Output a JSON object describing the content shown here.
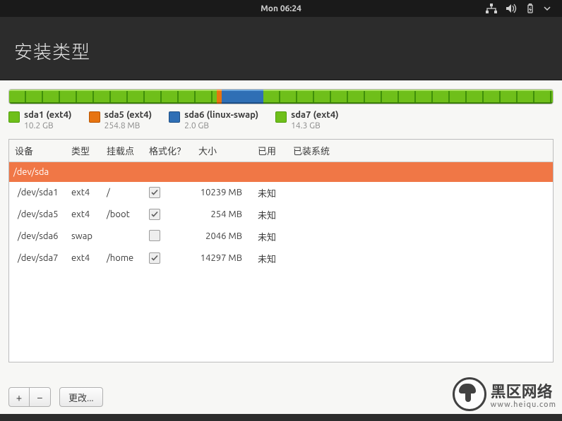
{
  "topbar": {
    "clock": "Mon 06:24"
  },
  "header": {
    "title": "安装类型"
  },
  "legend": [
    {
      "color": "green",
      "label": "sda1 (ext4)",
      "size": "10.2 GB"
    },
    {
      "color": "orange",
      "label": "sda5 (ext4)",
      "size": "254.8 MB"
    },
    {
      "color": "blue",
      "label": "sda6 (linux-swap)",
      "size": "2.0 GB"
    },
    {
      "color": "green",
      "label": "sda7 (ext4)",
      "size": "14.3 GB"
    }
  ],
  "columns": {
    "device": "设备",
    "type": "类型",
    "mount": "挂载点",
    "format": "格式化？",
    "size": "大小",
    "used": "已用",
    "system": "已装系统"
  },
  "rows": [
    {
      "device": "/dev/sda",
      "type": "",
      "mount": "",
      "format": null,
      "size": "",
      "used": "",
      "selected": true
    },
    {
      "device": "/dev/sda1",
      "type": "ext4",
      "mount": "/",
      "format": true,
      "size": "10239 MB",
      "used": "未知"
    },
    {
      "device": "/dev/sda5",
      "type": "ext4",
      "mount": "/boot",
      "format": true,
      "size": "254 MB",
      "used": "未知"
    },
    {
      "device": "/dev/sda6",
      "type": "swap",
      "mount": "",
      "format": false,
      "size": "2046 MB",
      "used": "未知"
    },
    {
      "device": "/dev/sda7",
      "type": "ext4",
      "mount": "/home",
      "format": true,
      "size": "14297 MB",
      "used": "未知"
    }
  ],
  "buttons": {
    "plus": "+",
    "minus": "−",
    "changes": "更改..."
  },
  "watermark": {
    "title": "黑区网络",
    "url": "www.heiqu.com"
  }
}
